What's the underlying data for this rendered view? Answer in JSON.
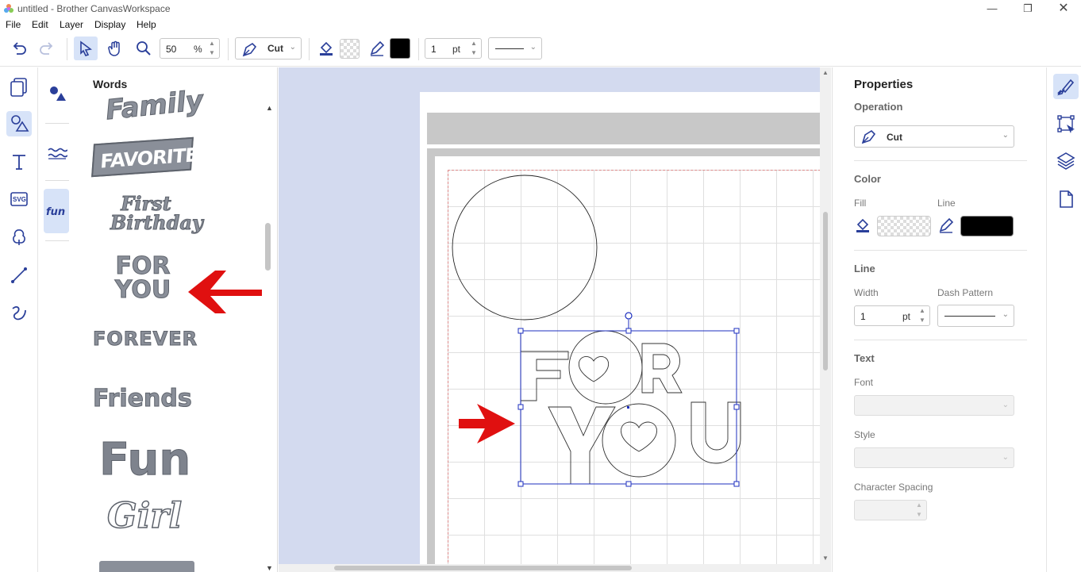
{
  "window": {
    "title": "untitled - Brother CanvasWorkspace"
  },
  "menu": [
    "File",
    "Edit",
    "Layer",
    "Display",
    "Help"
  ],
  "toolbar": {
    "zoom_value": "50",
    "zoom_unit": "%",
    "operation": "Cut",
    "line_width_value": "1",
    "line_width_unit": "pt",
    "line_color": "#000000"
  },
  "left_panel": {
    "header": "Words",
    "tools": [
      "project-icon",
      "shapes-icon",
      "text-icon",
      "svg-icon",
      "pattern-icon",
      "line-tool-icon",
      "freehand-icon"
    ],
    "categories": [
      "basic-shapes-icon",
      "wave-icon",
      "fun-icon"
    ],
    "words": [
      "Family",
      "FAVORITE",
      "First Birthday",
      "FOR YOU",
      "FOREVER",
      "Friends",
      "Fun",
      "Girl"
    ]
  },
  "properties": {
    "title": "Properties",
    "operation_label": "Operation",
    "operation_value": "Cut",
    "color_label": "Color",
    "fill_label": "Fill",
    "line_label": "Line",
    "line_color": "#000000",
    "line_section": "Line",
    "width_label": "Width",
    "width_value": "1",
    "width_unit": "pt",
    "dash_label": "Dash Pattern",
    "text_section": "Text",
    "font_label": "Font",
    "style_label": "Style",
    "spacing_label": "Character Spacing"
  },
  "right_tabs": [
    "properties-brush-icon",
    "transform-icon",
    "layers-icon",
    "page-icon"
  ],
  "canvas": {
    "selected_object": "FOR YOU"
  },
  "colors": {
    "accent": "#2a3f9a",
    "selection": "#1c2fbf",
    "arrow": "#e01010",
    "canvas_bg": "#d3daef"
  }
}
